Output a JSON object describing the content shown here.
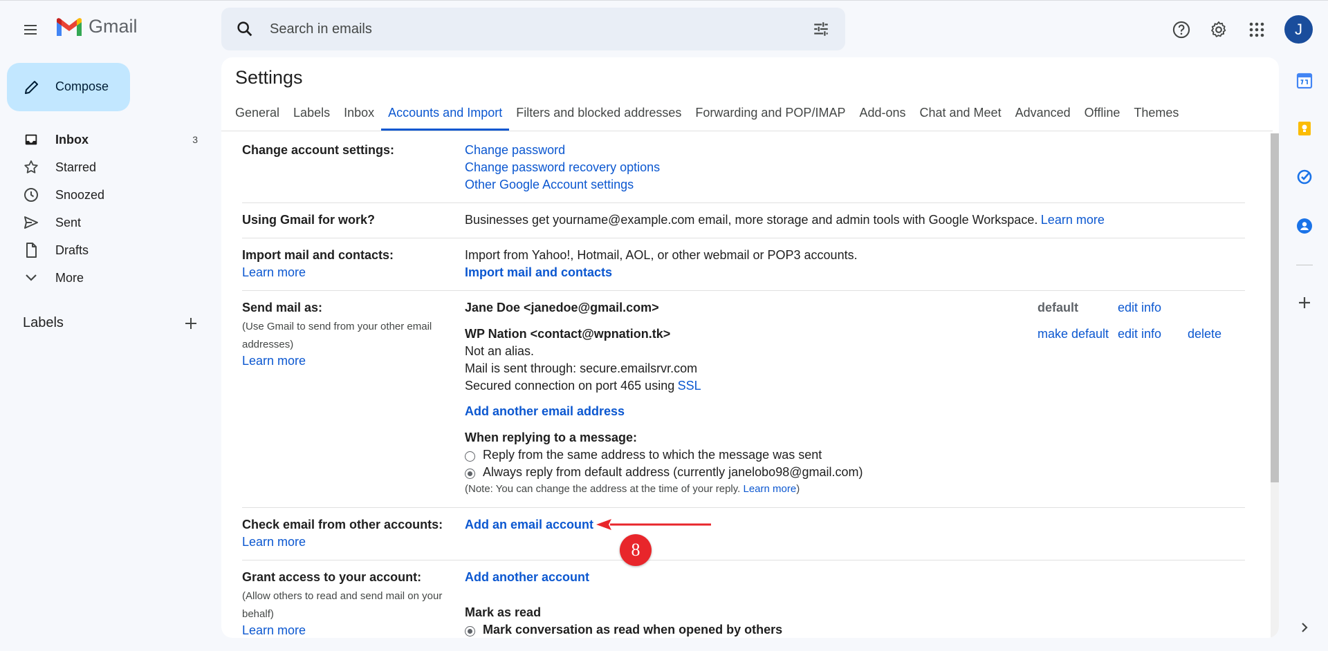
{
  "app": {
    "name": "Gmail"
  },
  "search": {
    "placeholder": "Search in emails"
  },
  "user": {
    "initial": "J"
  },
  "compose": {
    "label": "Compose"
  },
  "nav": [
    {
      "label": "Inbox",
      "count": "3",
      "icon": "inbox-icon"
    },
    {
      "label": "Starred",
      "count": "",
      "icon": "star-icon"
    },
    {
      "label": "Snoozed",
      "count": "",
      "icon": "clock-icon"
    },
    {
      "label": "Sent",
      "count": "",
      "icon": "send-icon"
    },
    {
      "label": "Drafts",
      "count": "",
      "icon": "draft-icon"
    },
    {
      "label": "More",
      "count": "",
      "icon": "chevron-down-icon"
    }
  ],
  "labels_heading": "Labels",
  "settings": {
    "title": "Settings",
    "tabs": [
      "General",
      "Labels",
      "Inbox",
      "Accounts and Import",
      "Filters and blocked addresses",
      "Forwarding and POP/IMAP",
      "Add-ons",
      "Chat and Meet",
      "Advanced",
      "Offline",
      "Themes"
    ],
    "active_tab": "Accounts and Import",
    "change_account": {
      "label": "Change account settings:",
      "links": [
        "Change password",
        "Change password recovery options",
        "Other Google Account settings"
      ]
    },
    "work": {
      "label": "Using Gmail for work?",
      "text": "Businesses get yourname@example.com email, more storage and admin tools with Google Workspace.",
      "link": "Learn more"
    },
    "import": {
      "label": "Import mail and contacts:",
      "learn": "Learn more",
      "text": "Import from Yahoo!, Hotmail, AOL, or other webmail or POP3 accounts.",
      "action": "Import mail and contacts"
    },
    "send_as": {
      "label": "Send mail as:",
      "sub1": "(Use Gmail to send from your other email",
      "sub2": "addresses)",
      "learn": "Learn more",
      "primary": "Jane Doe <janedoe@gmail.com>",
      "primary_status": "default",
      "primary_edit": "edit info",
      "alias": "WP Nation <contact@wpnation.tk>",
      "alias_make_default": "make default",
      "alias_edit": "edit info",
      "alias_delete": "delete",
      "alias_line1": "Not an alias.",
      "alias_line2": "Mail is sent through: secure.emailsrvr.com",
      "alias_line3": "Secured connection on port 465 using",
      "alias_ssl": "SSL",
      "add_another": "Add another email address",
      "reply_heading": "When replying to a message:",
      "reply_opt1": "Reply from the same address to which the message was sent",
      "reply_opt2": "Always reply from default address (currently janelobo98@gmail.com)",
      "note_pre": "(Note: You can change the address at the time of your reply.",
      "note_link": "Learn more",
      "note_post": ")"
    },
    "check_email": {
      "label": "Check email from other accounts:",
      "learn": "Learn more",
      "action": "Add an email account"
    },
    "grant": {
      "label": "Grant access to your account:",
      "sub1": "(Allow others to read and send mail on your",
      "sub2": "behalf)",
      "learn": "Learn more",
      "action": "Add another account",
      "mark_heading": "Mark as read",
      "mark_opt1": "Mark conversation as read when opened by others"
    }
  },
  "annotation": {
    "step": "8",
    "color": "#e8262b"
  },
  "colors": {
    "accent": "#0b57d0",
    "compose_bg": "#c2e7ff",
    "background": "#f6f8fc"
  }
}
